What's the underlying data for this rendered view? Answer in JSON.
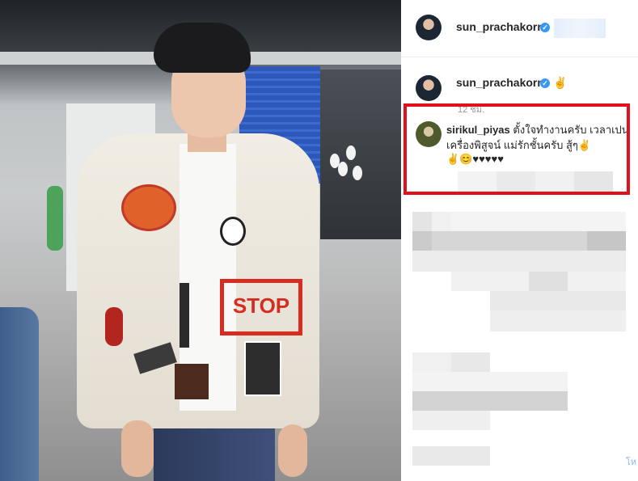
{
  "post": {
    "author": "sun_prachakorn",
    "verified": true
  },
  "caption": {
    "author": "sun_prachakorn",
    "emoji": "✌"
  },
  "timestamp": "12 ชม.",
  "highlighted_comment": {
    "author": "sirikul_piyas",
    "text": "ตั้งใจทำงานครับ เวลาเปนเครื่องพิสูจน์ แม่รักชั้นครับ สู้ๆ✌",
    "emoji_line": "✌😊♥♥♥♥♥"
  },
  "photo": {
    "jacket_text": "STOP"
  },
  "scroll_hint": "โห",
  "colors": {
    "verified_badge": "#3897f0",
    "highlight_border": "#e0111a",
    "username": "#262626"
  }
}
